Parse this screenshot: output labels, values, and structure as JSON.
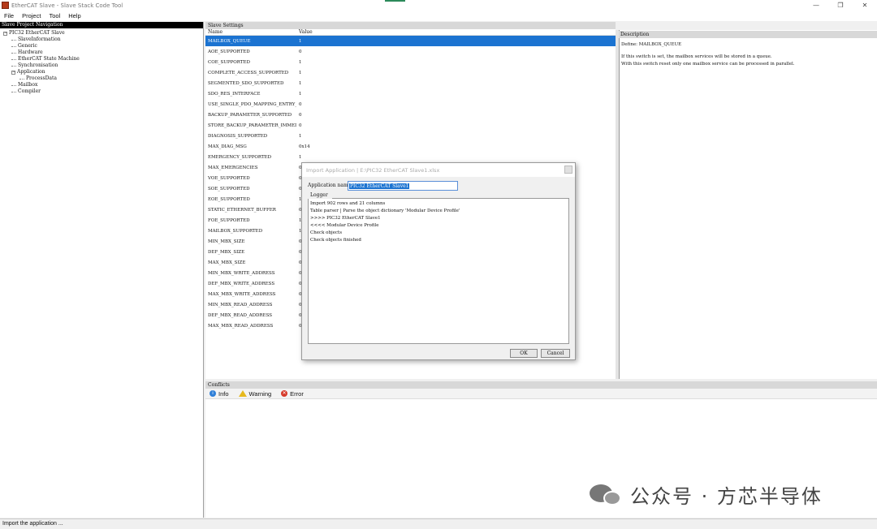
{
  "window": {
    "title": "EtherCAT Slave - Slave Stack Code Tool",
    "controls": [
      "—",
      "❐",
      "✕"
    ]
  },
  "menu": [
    "File",
    "Project",
    "Tool",
    "Help"
  ],
  "nav": {
    "header": "Slave Project Navigation",
    "tree": [
      {
        "label": "PIC32 EtherCAT Slave",
        "depth": 0,
        "toggle": "−"
      },
      {
        "label": "SlaveInformation",
        "depth": 1
      },
      {
        "label": "Generic",
        "depth": 1
      },
      {
        "label": "Hardware",
        "depth": 1
      },
      {
        "label": "EtherCAT State Machine",
        "depth": 1
      },
      {
        "label": "Synchronisation",
        "depth": 1
      },
      {
        "label": "Application",
        "depth": 1,
        "toggle": "−"
      },
      {
        "label": "ProcessData",
        "depth": 2
      },
      {
        "label": "Mailbox",
        "depth": 1
      },
      {
        "label": "Compiler",
        "depth": 1
      }
    ]
  },
  "settings": {
    "header": "Slave Settings",
    "col_name": "Name",
    "col_value": "Value",
    "rows": [
      {
        "name": "MAILBOX_QUEUE",
        "value": "1",
        "selected": true
      },
      {
        "name": "AOE_SUPPORTED",
        "value": "0"
      },
      {
        "name": "COE_SUPPORTED",
        "value": "1"
      },
      {
        "name": "COMPLETE_ACCESS_SUPPORTED",
        "value": "1"
      },
      {
        "name": "SEGMENTED_SDO_SUPPORTED",
        "value": "1"
      },
      {
        "name": "SDO_RES_INTERFACE",
        "value": "1"
      },
      {
        "name": "USE_SINGLE_PDO_MAPPING_ENTRY_...",
        "value": "0"
      },
      {
        "name": "BACKUP_PARAMETER_SUPPORTED",
        "value": "0"
      },
      {
        "name": "STORE_BACKUP_PARAMETER_IMMEDI...",
        "value": "0"
      },
      {
        "name": "DIAGNOSIS_SUPPORTED",
        "value": "1"
      },
      {
        "name": "MAX_DIAG_MSG",
        "value": "0x14"
      },
      {
        "name": "EMERGENCY_SUPPORTED",
        "value": "1"
      },
      {
        "name": "MAX_EMERGENCIES",
        "value": "0"
      },
      {
        "name": "VOE_SUPPORTED",
        "value": "0"
      },
      {
        "name": "SOE_SUPPORTED",
        "value": "0"
      },
      {
        "name": "EOE_SUPPORTED",
        "value": "1"
      },
      {
        "name": "STATIC_ETHERNET_BUFFER",
        "value": "0"
      },
      {
        "name": "FOE_SUPPORTED",
        "value": "1"
      },
      {
        "name": "MAILBOX_SUPPORTED",
        "value": "1"
      },
      {
        "name": "MIN_MBX_SIZE",
        "value": "0"
      },
      {
        "name": "DEF_MBX_SIZE",
        "value": "0"
      },
      {
        "name": "MAX_MBX_SIZE",
        "value": "0"
      },
      {
        "name": "MIN_MBX_WRITE_ADDRESS",
        "value": "0"
      },
      {
        "name": "DEF_MBX_WRITE_ADDRESS",
        "value": "0"
      },
      {
        "name": "MAX_MBX_WRITE_ADDRESS",
        "value": "0"
      },
      {
        "name": "MIN_MBX_READ_ADDRESS",
        "value": "0"
      },
      {
        "name": "DEF_MBX_READ_ADDRESS",
        "value": "0"
      },
      {
        "name": "MAX_MBX_READ_ADDRESS",
        "value": "0"
      }
    ]
  },
  "description": {
    "header": "Description",
    "define": "Define: MAILBOX_QUEUE",
    "lines": [
      "If this switch is set, the mailbox services will be stored in a queue.",
      "With this switch reset only one mailbox service can be processed in parallel."
    ]
  },
  "conflicts": {
    "header": "Conflicts",
    "tabs": [
      {
        "label": "Info",
        "icon": "info-icon"
      },
      {
        "label": "Warning",
        "icon": "warning-icon"
      },
      {
        "label": "Error",
        "icon": "error-icon"
      }
    ]
  },
  "status": "Import the application ...",
  "dialog": {
    "title": "Import Application | E:\\PIC32 EtherCAT Slave1.xlsx",
    "app_name_label": "Application name",
    "app_name_value": "PIC32 EtherCAT Slave1",
    "logger_label": "Logger",
    "log_lines": [
      "Import 902 rows and 21 columns",
      "Table parser | Parse the object dictionary 'Modular Device Profile'",
      ">>>> PIC32 EtherCAT Slave1",
      "<<<< Modular Device Profile",
      "Check objects",
      "Check objects finished"
    ],
    "ok_label": "OK",
    "cancel_label": "Cancel"
  },
  "watermark": {
    "text": "公众号 · 方芯半导体"
  }
}
